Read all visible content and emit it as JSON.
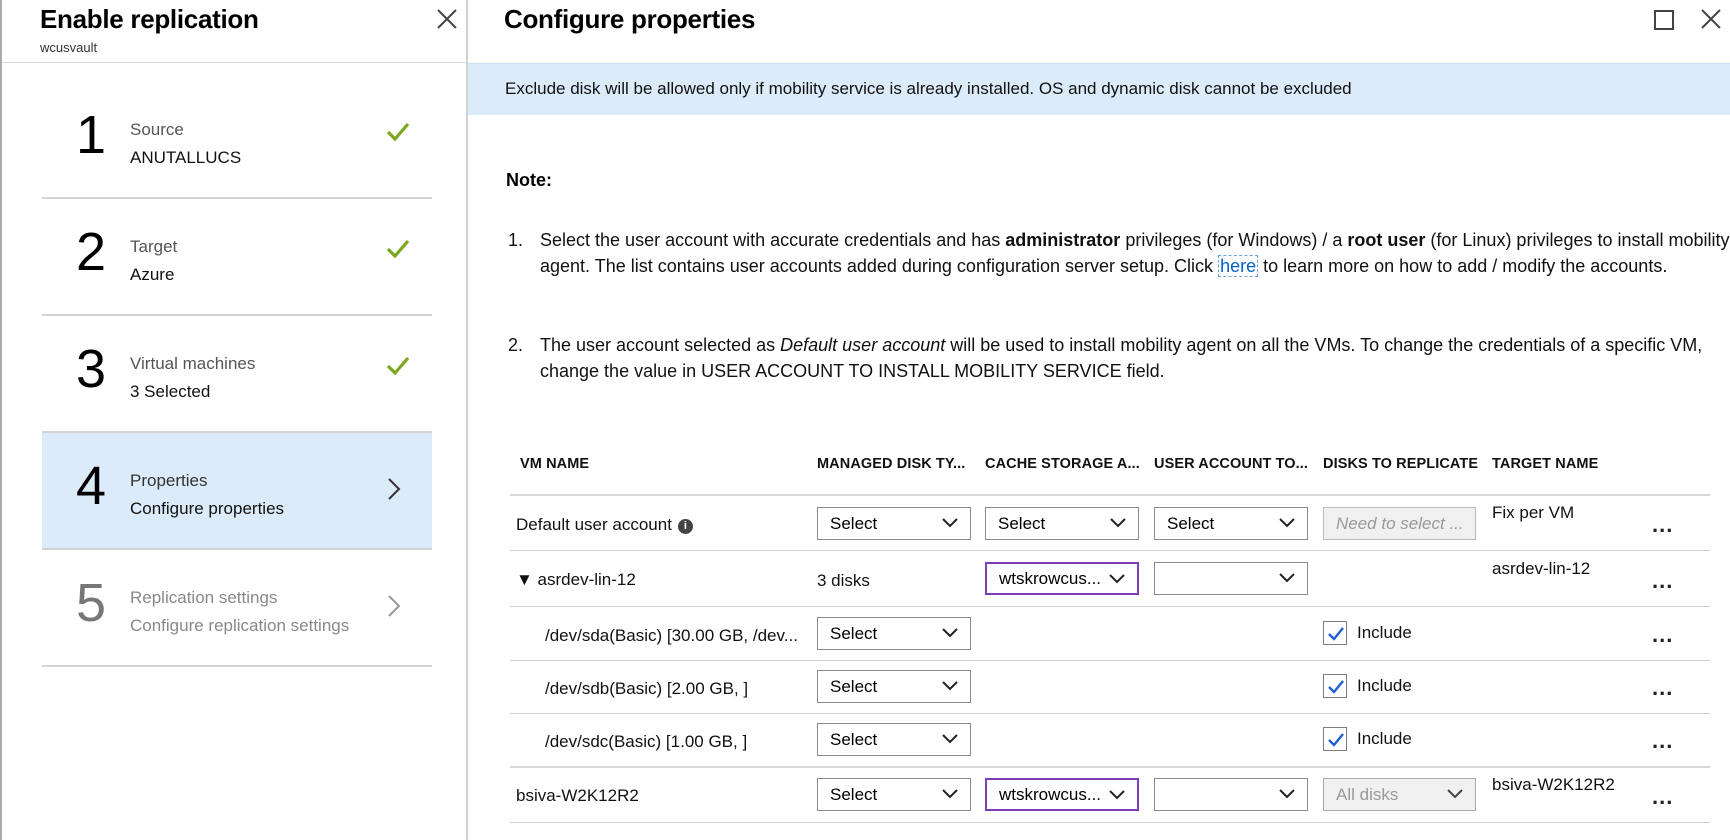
{
  "left": {
    "title": "Enable replication",
    "subtitle": "wcusvault",
    "steps": [
      {
        "num": "1",
        "label": "Source",
        "value": "ANUTALLUCS",
        "status": "done"
      },
      {
        "num": "2",
        "label": "Target",
        "value": "Azure",
        "status": "done"
      },
      {
        "num": "3",
        "label": "Virtual machines",
        "value": "3 Selected",
        "status": "done"
      },
      {
        "num": "4",
        "label": "Properties",
        "value": "Configure properties",
        "status": "active"
      },
      {
        "num": "5",
        "label": "Replication settings",
        "value": "Configure replication settings",
        "status": "disabled"
      }
    ]
  },
  "right": {
    "title": "Configure properties",
    "banner": "Exclude disk will be allowed only if mobility service is already installed. OS and dynamic disk cannot be excluded",
    "note_title": "Note:",
    "note1": {
      "num": "1.",
      "part1": "Select the user account with accurate credentials and has ",
      "bold1": "administrator",
      "part2": " privileges (for Windows) / a ",
      "bold2": "root user",
      "part3": " (for Linux) privileges to install mobility agent. The list contains user accounts added during configuration server setup. Click ",
      "link": "here",
      "part4": " to learn more on how to add / modify the accounts."
    },
    "note2": {
      "num": "2.",
      "part1": "The user account selected as ",
      "italic": "Default user account",
      "part2": " will be used to install mobility agent on all the VMs. To change the credentials of a specific VM, change the value in USER ACCOUNT TO INSTALL MOBILITY SERVICE field."
    }
  },
  "table": {
    "headers": {
      "vm_name": "VM NAME",
      "managed_disk": "MANAGED DISK TY...",
      "cache_storage": "CACHE STORAGE A...",
      "user_account": "USER ACCOUNT TO...",
      "disks_to_replicate": "DISKS TO REPLICATE",
      "target_name": "TARGET NAME"
    },
    "default_row": {
      "name": "Default user account",
      "managed_disk": "Select",
      "cache_storage": "Select",
      "user_account": "Select",
      "disks": "Need to select ...",
      "target": "Fix per VM"
    },
    "vm1": {
      "name": "▼ asrdev-lin-12",
      "disks_count": "3 disks",
      "cache_storage": "wtskrowcus...",
      "user_account": "",
      "target": "asrdev-lin-12"
    },
    "disk_rows": [
      {
        "name": "/dev/sda(Basic) [30.00 GB, /dev...",
        "managed_disk": "Select",
        "include": "Include",
        "checked": true
      },
      {
        "name": "/dev/sdb(Basic) [2.00 GB, ]",
        "managed_disk": "Select",
        "include": "Include",
        "checked": true
      },
      {
        "name": "/dev/sdc(Basic) [1.00 GB, ]",
        "managed_disk": "Select",
        "include": "Include",
        "checked": true
      }
    ],
    "vm2": {
      "name": "bsiva-W2K12R2",
      "managed_disk": "Select",
      "cache_storage": "wtskrowcus...",
      "user_account": "",
      "disks": "All disks",
      "target": "bsiva-W2K12R2"
    },
    "more": "..."
  },
  "colors": {
    "accent_bg": "#dcebfa",
    "check_green": "#7aa81e",
    "purple_border": "#7a3fb8",
    "link": "#0060c6"
  },
  "icons": {
    "close": "close-icon",
    "maximize": "maximize-icon",
    "check": "checkmark-icon",
    "chevron_right": "chevron-right-icon",
    "chevron_down": "chevron-down-icon",
    "info": "info-icon"
  }
}
